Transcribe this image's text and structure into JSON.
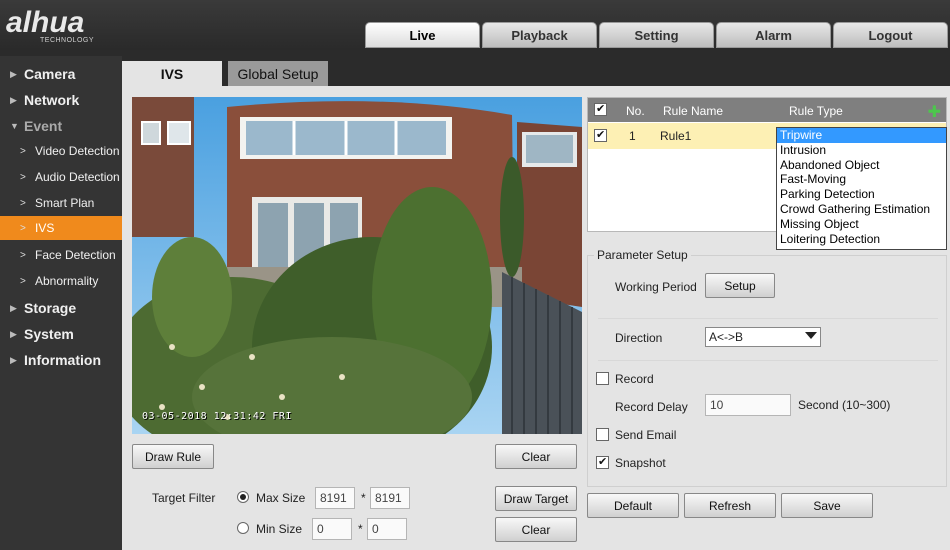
{
  "header": {
    "logo_text": "alhua",
    "logo_sub": "TECHNOLOGY",
    "tabs": [
      "Live",
      "Playback",
      "Setting",
      "Alarm",
      "Logout"
    ]
  },
  "sidebar": {
    "top": [
      "Camera",
      "Network",
      "Event",
      "Storage",
      "System",
      "Information"
    ],
    "event_items": [
      "Video Detection",
      "Audio Detection",
      "Smart Plan",
      "IVS",
      "Face Detection",
      "Abnormality"
    ]
  },
  "subtabs": {
    "ivs": "IVS",
    "global": "Global Setup"
  },
  "video": {
    "timestamp": "03-05-2018 12:31:42 FRI"
  },
  "buttons": {
    "draw_rule": "Draw Rule",
    "clear": "Clear",
    "draw_target": "Draw Target",
    "clear2": "Clear",
    "default": "Default",
    "refresh": "Refresh",
    "save": "Save",
    "setup": "Setup"
  },
  "target_filter": {
    "label": "Target Filter",
    "max_label": "Max Size",
    "min_label": "Min Size",
    "max_w": "8191",
    "max_h": "8191",
    "min_w": "0",
    "min_h": "0",
    "times": "*"
  },
  "rules": {
    "headers": {
      "no": "No.",
      "name": "Rule Name",
      "type": "Rule Type"
    },
    "rows": [
      {
        "no": "1",
        "name": "Rule1"
      }
    ],
    "type_options": [
      "Tripwire",
      "Intrusion",
      "Abandoned Object",
      "Fast-Moving",
      "Parking Detection",
      "Crowd Gathering Estimation",
      "Missing Object",
      "Loitering Detection"
    ],
    "selected_type": "Tripwire"
  },
  "params": {
    "title": "Parameter Setup",
    "working_period": "Working Period",
    "direction_label": "Direction",
    "direction_value": "A<->B",
    "record": "Record",
    "record_delay": "Record Delay",
    "record_delay_value": "10",
    "record_delay_unit": "Second (10~300)",
    "send_email": "Send Email",
    "snapshot": "Snapshot"
  },
  "colors": {
    "accent": "#f08a1c",
    "selected": "#3399ff",
    "row_highlight": "#fdf0b4"
  }
}
